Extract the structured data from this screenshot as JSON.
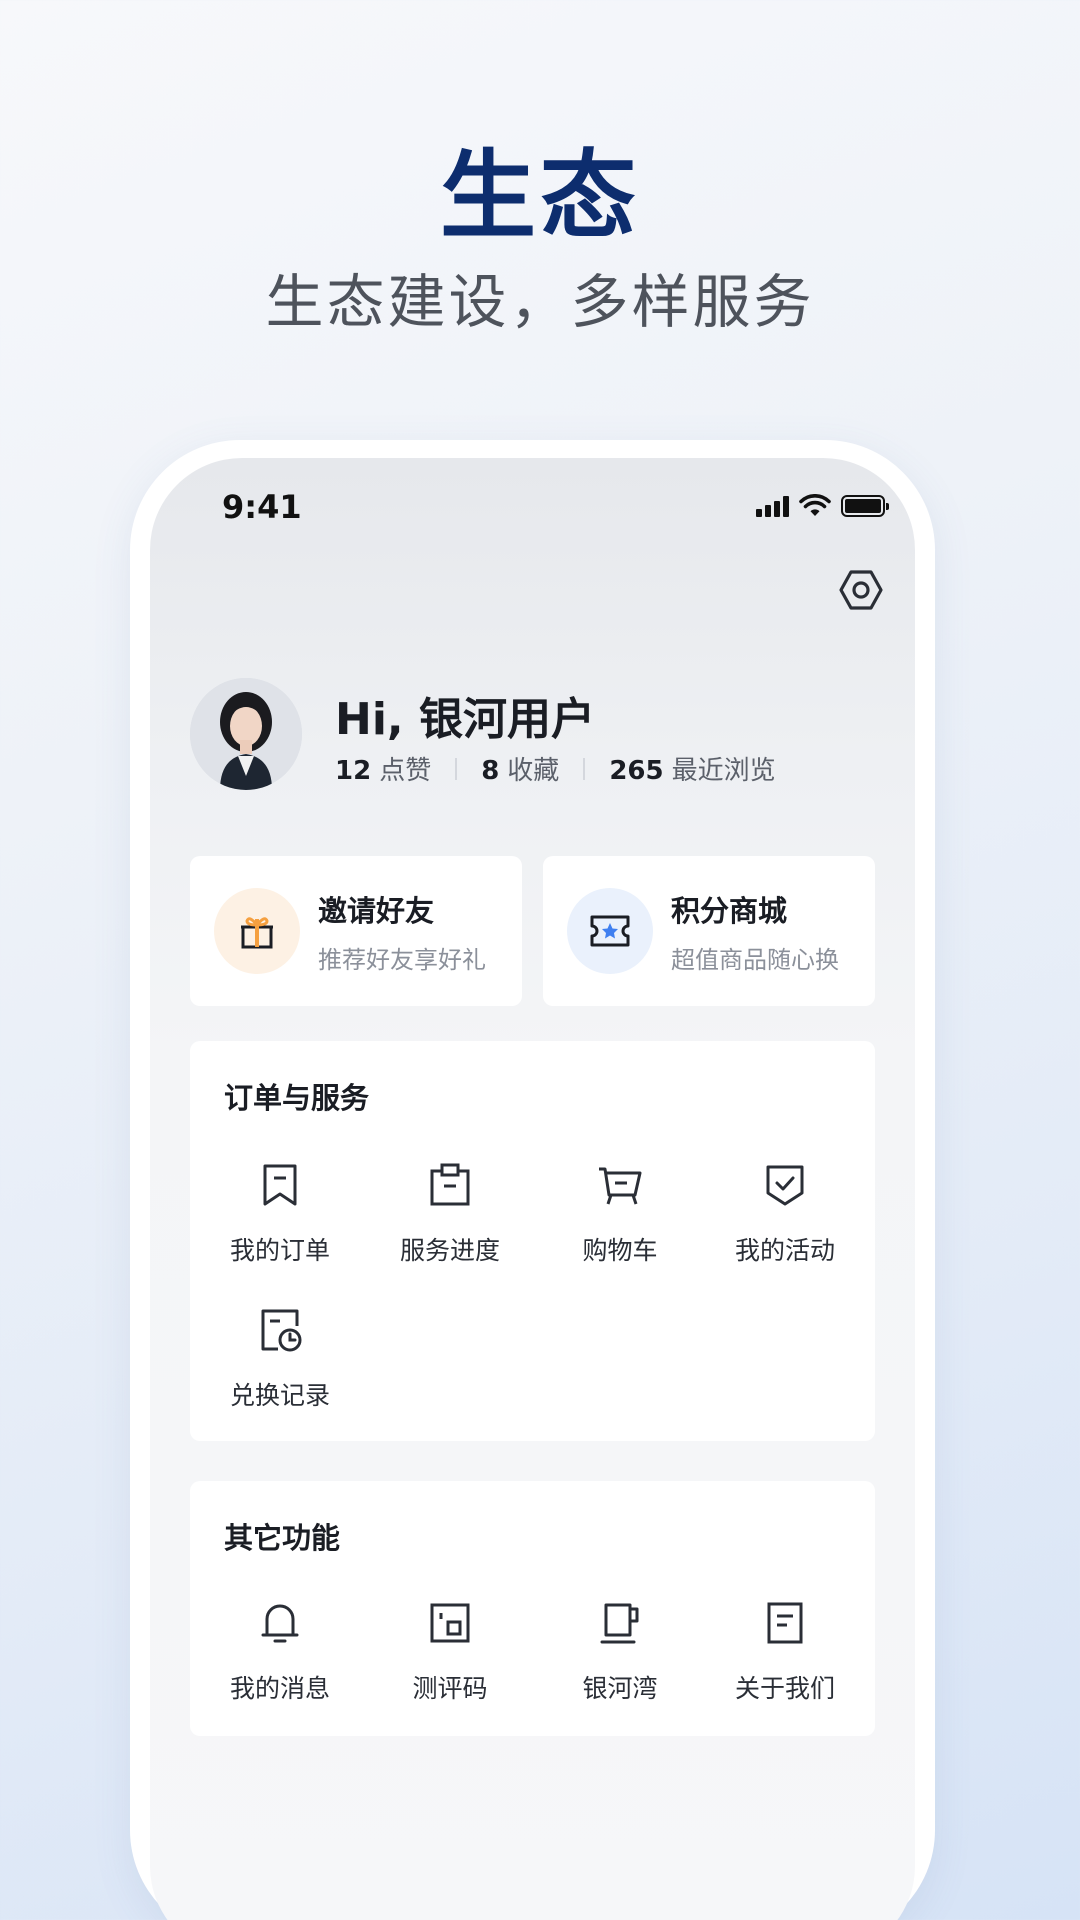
{
  "hero": {
    "title": "生态",
    "subtitle": "生态建设，多样服务"
  },
  "status_bar": {
    "time": "9:41"
  },
  "profile": {
    "greeting": "Hi, 银河用户",
    "stats": [
      {
        "value": "12",
        "label": "点赞"
      },
      {
        "value": "8",
        "label": "收藏"
      },
      {
        "value": "265",
        "label": "最近浏览"
      }
    ]
  },
  "promos": [
    {
      "title": "邀请好友",
      "subtitle": "推荐好友享好礼",
      "icon": "gift-icon"
    },
    {
      "title": "积分商城",
      "subtitle": "超值商品随心换",
      "icon": "ticket-star-icon"
    }
  ],
  "orders": {
    "title": "订单与服务",
    "items": [
      {
        "label": "我的订单",
        "icon": "bookmark-icon"
      },
      {
        "label": "服务进度",
        "icon": "clipboard-icon"
      },
      {
        "label": "购物车",
        "icon": "cart-icon"
      },
      {
        "label": "我的活动",
        "icon": "shield-check-icon"
      },
      {
        "label": "兑换记录",
        "icon": "receipt-clock-icon"
      }
    ]
  },
  "others": {
    "title": "其它功能",
    "items": [
      {
        "label": "我的消息",
        "icon": "bell-icon"
      },
      {
        "label": "测评码",
        "icon": "qr-code-icon"
      },
      {
        "label": "银河湾",
        "icon": "mug-icon"
      },
      {
        "label": "关于我们",
        "icon": "document-icon"
      }
    ]
  },
  "colors": {
    "brand": "#0d2d6e",
    "gift_accent": "#f5a040",
    "ticket_accent": "#3f7ff0"
  }
}
